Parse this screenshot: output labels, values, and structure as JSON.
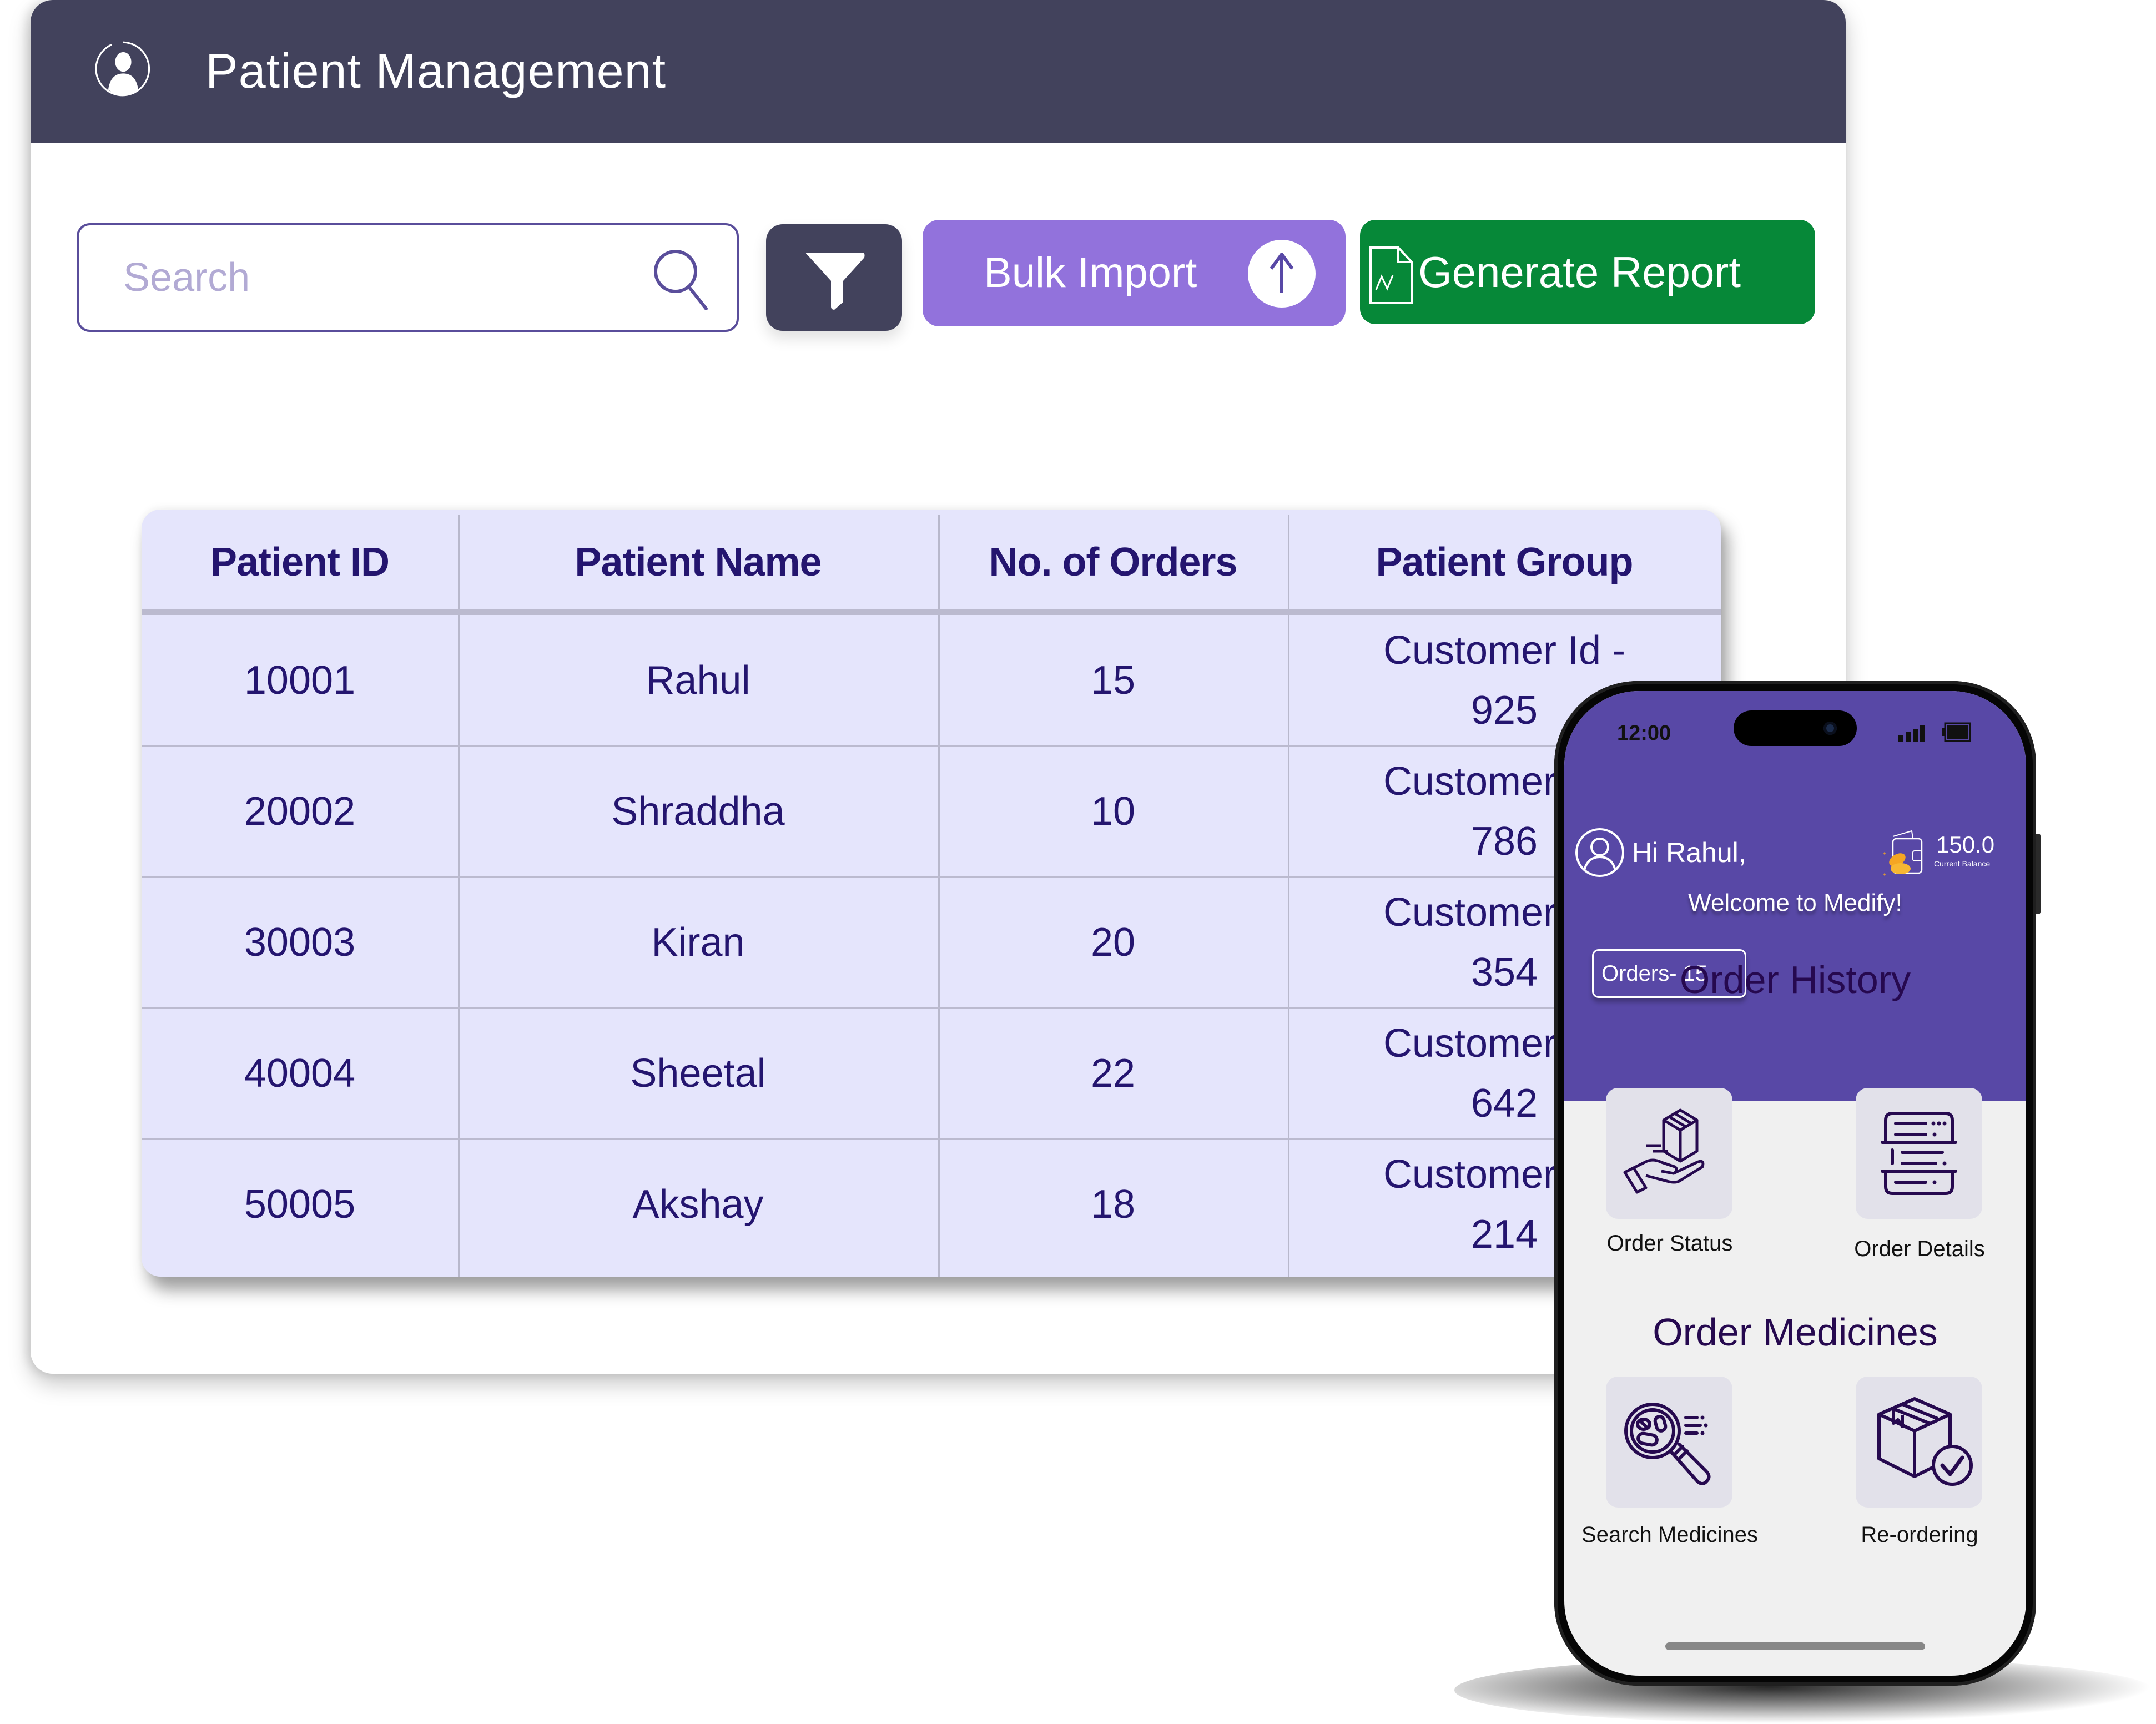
{
  "app": {
    "title": "Patient Management",
    "title_icon": "user-circle-icon"
  },
  "toolbar": {
    "search": {
      "placeholder": "Search",
      "value": "",
      "icon": "search-icon"
    },
    "filter": {
      "icon": "filter-icon"
    },
    "bulk_import": {
      "label": "Bulk Import",
      "icon": "upload-arrow-icon",
      "color": "#9272dc"
    },
    "generate_report": {
      "label": "Generate Report",
      "icon": "report-chart-icon",
      "color": "#068838"
    }
  },
  "table": {
    "columns": [
      "Patient ID",
      "Patient Name",
      "No. of Orders",
      "Patient Group"
    ],
    "rows": [
      {
        "id": "10001",
        "name": "Rahul",
        "orders": "15",
        "group": "Customer Id -",
        "group_id": "925"
      },
      {
        "id": "20002",
        "name": "Shraddha",
        "orders": "10",
        "group": "Customer Id -",
        "group_id": "786"
      },
      {
        "id": "30003",
        "name": "Kiran",
        "orders": "20",
        "group": "Customer Id -",
        "group_id": "354"
      },
      {
        "id": "40004",
        "name": "Sheetal",
        "orders": "22",
        "group": "Customer Id -",
        "group_id": "642"
      },
      {
        "id": "50005",
        "name": "Akshay",
        "orders": "18",
        "group": "Customer Id -",
        "group_id": "214"
      }
    ]
  },
  "phone": {
    "status": {
      "time": "12:00",
      "signal_icon": "signal-icon",
      "battery_icon": "battery-icon"
    },
    "greeting": "Hi Rahul,",
    "balance": {
      "value": "150.0",
      "label": "Current Balance",
      "icon": "wallet-coins-icon"
    },
    "welcome": "Welcome to Medify!",
    "orders_chip": "Orders-  15",
    "sections": [
      {
        "title": "Order History",
        "tiles": [
          {
            "label": "Order Status",
            "icon": "package-hand-icon"
          },
          {
            "label": "Order Details",
            "icon": "order-list-icon"
          }
        ]
      },
      {
        "title": "Order Medicines",
        "tiles": [
          {
            "label": "Search Medicines",
            "icon": "pill-search-icon"
          },
          {
            "label": "Re-ordering",
            "icon": "box-check-icon"
          }
        ]
      }
    ],
    "accent": "#5848a6",
    "heading_color": "#26094f"
  },
  "colors": {
    "header_bg": "#42425c",
    "table_bg": "#e5e5fc",
    "table_text": "#24156f"
  }
}
